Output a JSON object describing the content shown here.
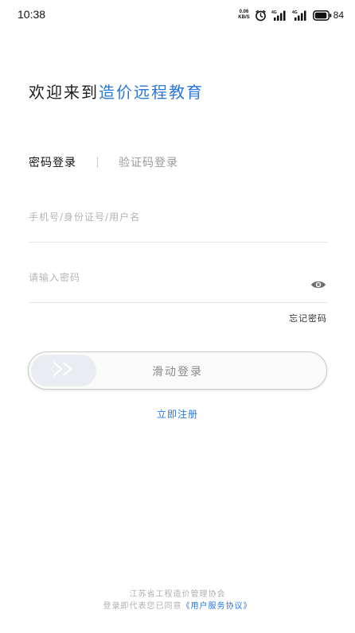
{
  "status_bar": {
    "time": "10:38",
    "net_speed_value": "0.06",
    "net_speed_unit": "KB/S",
    "signal_1_label": "4G",
    "signal_2_label": "4G",
    "battery_level": "84"
  },
  "header": {
    "welcome_prefix": "欢迎来到",
    "brand_name": "造价远程教育"
  },
  "tabs": [
    {
      "label": "密码登录",
      "active": true
    },
    {
      "label": "验证码登录",
      "active": false
    }
  ],
  "form": {
    "account_placeholder": "手机号/身份证号/用户名",
    "password_placeholder": "请输入密码",
    "forgot_password": "忘记密码"
  },
  "slider": {
    "label": "滑动登录",
    "handle_icon": "double-chevron-right-icon"
  },
  "register": {
    "label": "立即注册"
  },
  "footer": {
    "organization": "江苏省工程造价管理协会",
    "consent_prefix": "登录即代表您已同意",
    "agreement_link": "《用户服务协议》"
  },
  "colors": {
    "brand": "#2b76d9",
    "text": "#1d1d1d",
    "placeholder": "#b4b4b4"
  }
}
